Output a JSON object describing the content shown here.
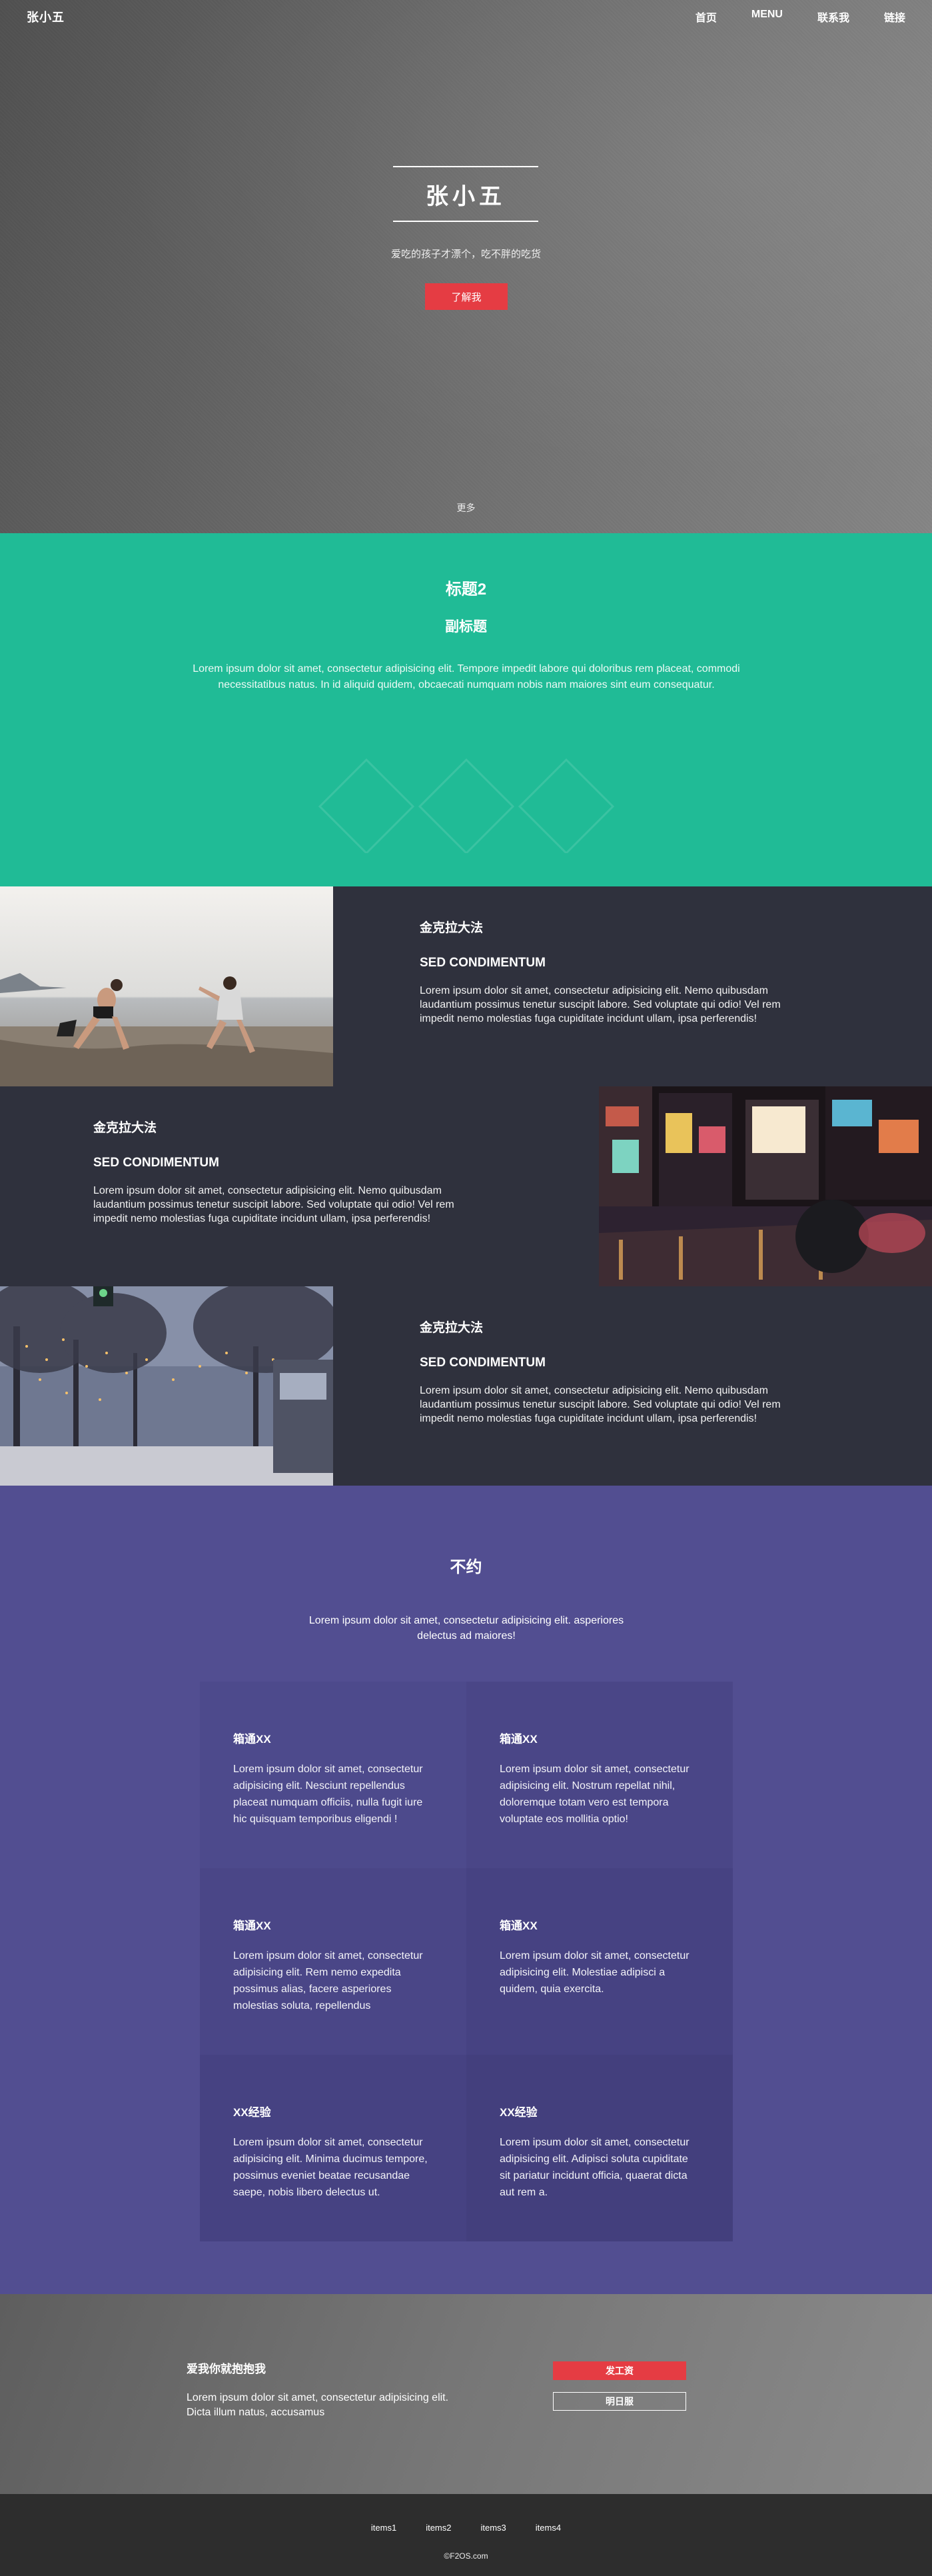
{
  "nav": {
    "brand": "张小五",
    "links": [
      "首页",
      "MENU",
      "联系我",
      "链接"
    ]
  },
  "hero": {
    "title": "张小五",
    "subtitle": "爱吃的孩子才漂个，吃不胖的吃货",
    "button": "了解我",
    "more": "更多"
  },
  "intro": {
    "title": "标题2",
    "subtitle": "副标题",
    "text": "Lorem ipsum dolor sit amet, consectetur adipisicing elit. Tempore impedit labore qui doloribus rem placeat, commodi necessitatibus natus. In id aliquid quidem, obcaecati numquam nobis nam maiores sint eum consequatur."
  },
  "spotlights": [
    {
      "title": "金克拉大法",
      "subtitle": "SED CONDIMENTUM",
      "text": "Lorem ipsum dolor sit amet, consectetur adipisicing elit. Nemo quibusdam laudantium possimus tenetur suscipit labore. Sed voluptate qui odio! Vel rem impedit nemo molestias fuga cupiditate incidunt ullam, ipsa perferendis!"
    },
    {
      "title": "金克拉大法",
      "subtitle": "SED CONDIMENTUM",
      "text": "Lorem ipsum dolor sit amet, consectetur adipisicing elit. Nemo quibusdam laudantium possimus tenetur suscipit labore. Sed voluptate qui odio! Vel rem impedit nemo molestias fuga cupiditate incidunt ullam, ipsa perferendis!"
    },
    {
      "title": "金克拉大法",
      "subtitle": "SED CONDIMENTUM",
      "text": "Lorem ipsum dolor sit amet, consectetur adipisicing elit. Nemo quibusdam laudantium possimus tenetur suscipit labore. Sed voluptate qui odio! Vel rem impedit nemo molestias fuga cupiditate incidunt ullam, ipsa perferendis!"
    }
  ],
  "features": {
    "title": "不约",
    "lead": "Lorem ipsum dolor sit amet, consectetur adipisicing elit. asperiores delectus ad maiores!",
    "items": [
      {
        "title": "箱通XX",
        "text": "Lorem ipsum dolor sit amet, consectetur adipisicing elit. Nesciunt repellendus placeat numquam officiis, nulla fugit iure hic quisquam temporibus eligendi !"
      },
      {
        "title": "箱通XX",
        "text": "Lorem ipsum dolor sit amet, consectetur adipisicing elit. Nostrum repellat nihil, doloremque totam vero est tempora voluptate eos mollitia optio!"
      },
      {
        "title": "箱通XX",
        "text": "Lorem ipsum dolor sit amet, consectetur adipisicing elit. Rem nemo expedita possimus alias, facere asperiores molestias soluta, repellendus"
      },
      {
        "title": "箱通XX",
        "text": "Lorem ipsum dolor sit amet, consectetur adipisicing elit. Molestiae adipisci a quidem, quia exercita."
      },
      {
        "title": "XX经验",
        "text": "Lorem ipsum dolor sit amet, consectetur adipisicing elit. Minima ducimus tempore, possimus eveniet beatae recusandae saepe, nobis libero delectus ut."
      },
      {
        "title": "XX经验",
        "text": "Lorem ipsum dolor sit amet, consectetur adipisicing elit. Adipisci soluta cupiditate sit pariatur incidunt officia, quaerat dicta aut rem a."
      }
    ]
  },
  "cta": {
    "title": "爱我你就抱抱我",
    "text": "Lorem ipsum dolor sit amet, consectetur adipisicing elit. Dicta illum natus, accusamus",
    "primary": "发工资",
    "secondary": "明日服"
  },
  "footer": {
    "items": [
      "items1",
      "items2",
      "items3",
      "items4"
    ],
    "copyright": "©F2OS.com"
  },
  "colors": {
    "accent": "#e53c43",
    "green": "#20bb96",
    "purple": "#524e91",
    "dark": "#2f313d"
  }
}
